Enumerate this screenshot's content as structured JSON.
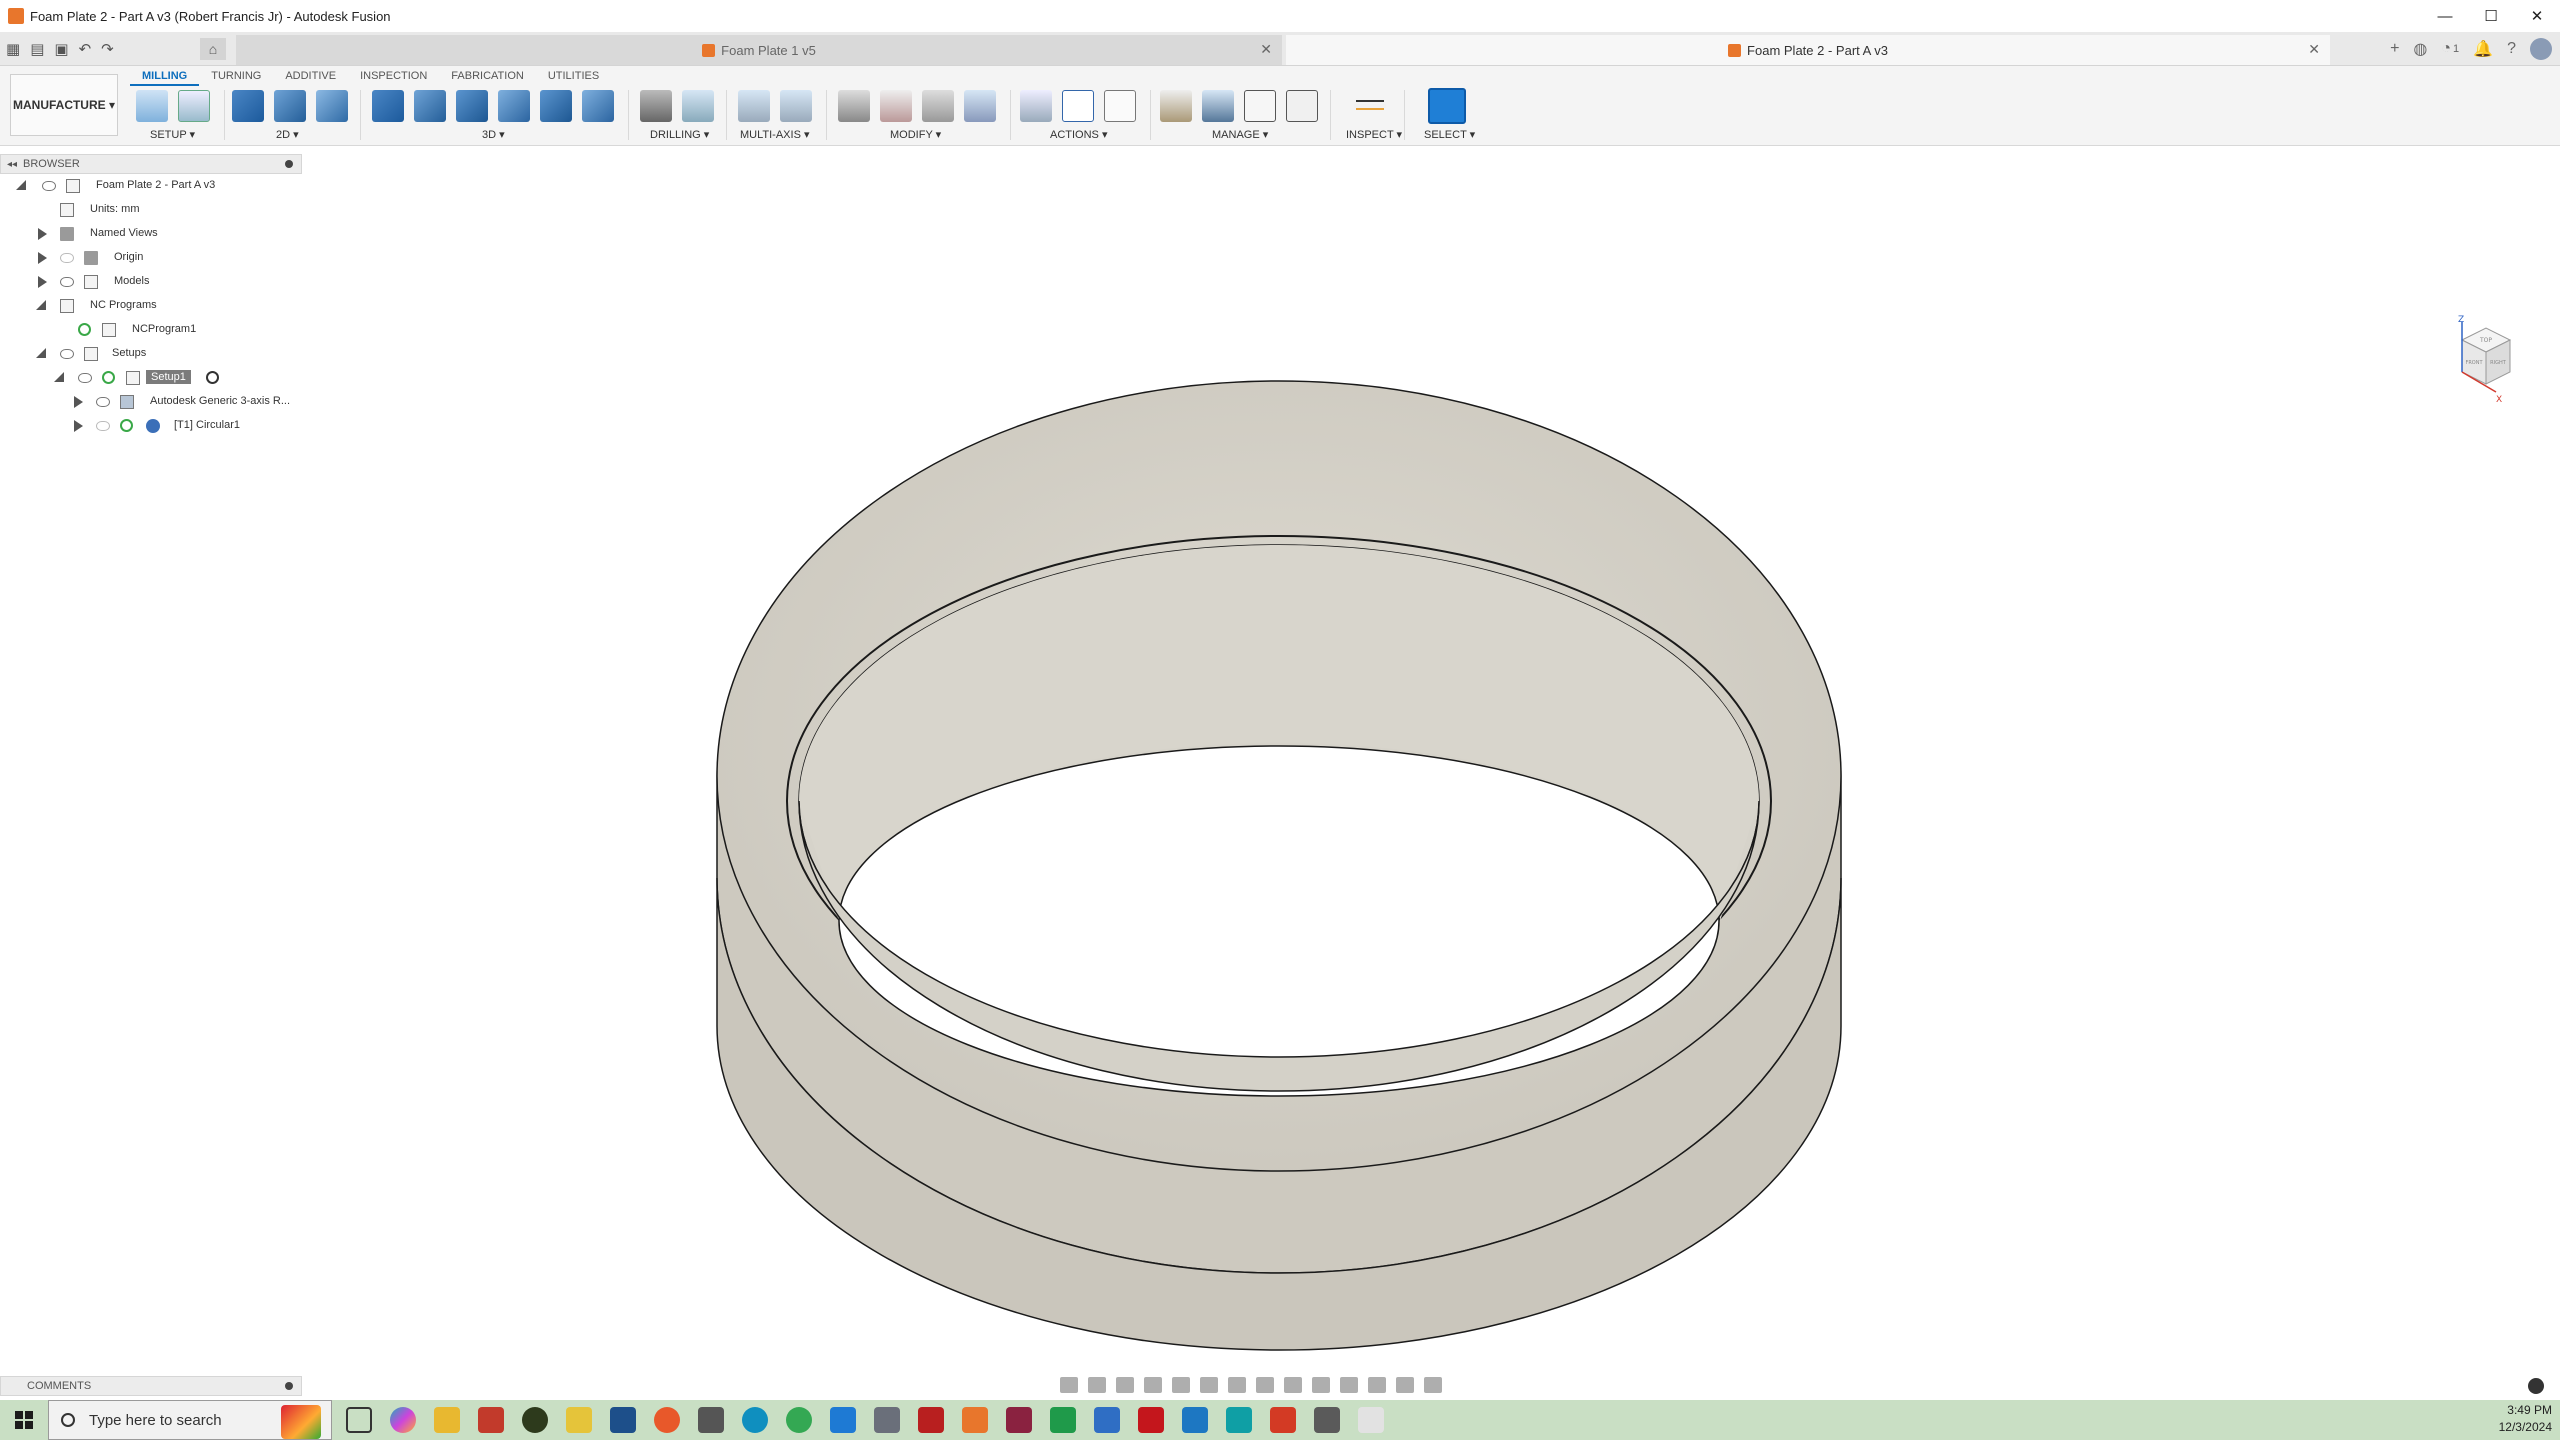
{
  "window": {
    "title": "Foam Plate 2 - Part A v3 (Robert Francis Jr) - Autodesk Fusion",
    "controls": [
      "—",
      "☐",
      "✕"
    ]
  },
  "tabs": [
    {
      "label": "Foam Plate 1 v5",
      "active": false
    },
    {
      "label": "Foam Plate 2 - Part A v3",
      "active": true
    }
  ],
  "tabbar_right": {
    "job_count": "1"
  },
  "ribbon": {
    "workspace": "MANUFACTURE ▾",
    "tabs": [
      "MILLING",
      "TURNING",
      "ADDITIVE",
      "INSPECTION",
      "FABRICATION",
      "UTILITIES"
    ],
    "groups": {
      "setup": "SETUP ▾",
      "twod": "2D ▾",
      "threed": "3D ▾",
      "drilling": "DRILLING ▾",
      "multiaxis": "MULTI-AXIS ▾",
      "modify": "MODIFY ▾",
      "actions": "ACTIONS ▾",
      "manage": "MANAGE ▾",
      "inspect": "INSPECT ▾",
      "select": "SELECT ▾"
    }
  },
  "browser": {
    "title": "BROWSER",
    "items": [
      {
        "label": "Foam Plate 2 - Part A v3"
      },
      {
        "label": "Units: mm"
      },
      {
        "label": "Named Views"
      },
      {
        "label": "Origin"
      },
      {
        "label": "Models"
      },
      {
        "label": "NC Programs"
      },
      {
        "label": "NCProgram1"
      },
      {
        "label": "Setups"
      },
      {
        "label": "Setup1"
      },
      {
        "label": "Autodesk Generic 3-axis R..."
      },
      {
        "label": "[T1] Circular1"
      }
    ]
  },
  "comments": {
    "title": "COMMENTS"
  },
  "viewcube": {
    "top": "TOP",
    "front": "FRONT",
    "right": "RIGHT",
    "axis_z": "Z",
    "axis_x": "X"
  },
  "taskbar": {
    "search_placeholder": "Type here to search",
    "time": "3:49 PM",
    "date": "12/3/2024"
  },
  "colors": {
    "model_fill": "#d9d6cd",
    "model_shade": "#c6c2b8",
    "accent": "#0d6ebd",
    "taskbar": "#c9dfc4"
  }
}
